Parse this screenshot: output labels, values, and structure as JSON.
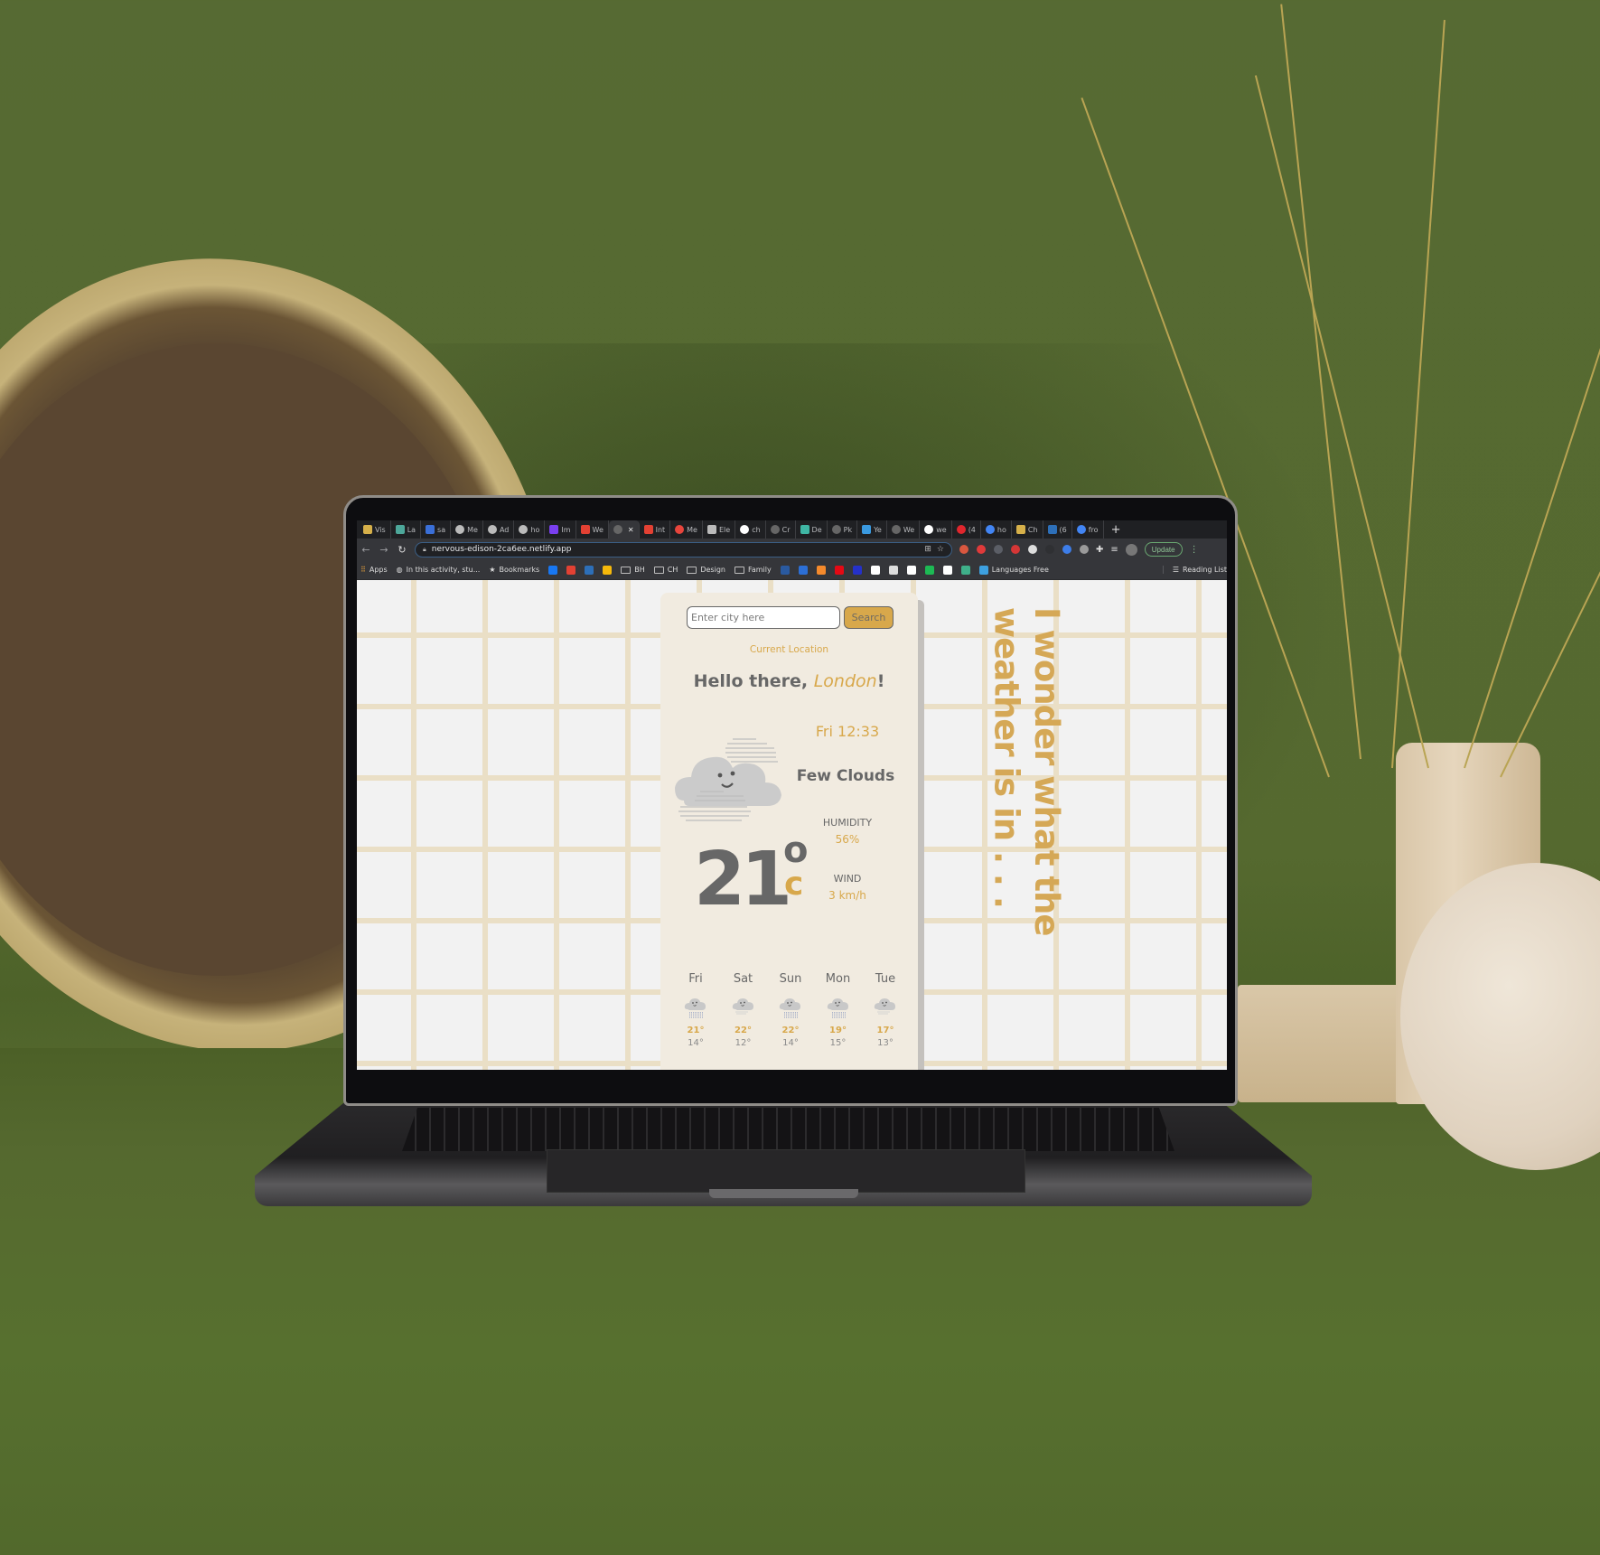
{
  "browser": {
    "tabs": [
      {
        "label": "Vis",
        "icon": "vscode-icon",
        "color": "#d6b04a"
      },
      {
        "label": "La",
        "icon": "app-icon",
        "color": "#4da79a"
      },
      {
        "label": "sa",
        "icon": "s-logo-icon",
        "color": "#3a6fd8"
      },
      {
        "label": "Me",
        "icon": "codesandbox-icon",
        "color": "#bbbbbb"
      },
      {
        "label": "Ad",
        "icon": "codesandbox-icon",
        "color": "#bbbbbb"
      },
      {
        "label": "ho",
        "icon": "codesandbox-icon",
        "color": "#bbbbbb"
      },
      {
        "label": "Im",
        "icon": "bootstrap-icon",
        "color": "#7a3ff0"
      },
      {
        "label": "We",
        "icon": "gmail-icon",
        "color": "#e34133"
      },
      {
        "label": "",
        "icon": "globe-icon",
        "color": "#666666",
        "active": true
      },
      {
        "label": "Int",
        "icon": "gmail-icon",
        "color": "#e34133"
      },
      {
        "label": "Me",
        "icon": "hexagon-icon",
        "color": "#e8453c"
      },
      {
        "label": "Ele",
        "icon": "lock-icon",
        "color": "#bbbbbb"
      },
      {
        "label": "ch",
        "icon": "github-icon",
        "color": "#ffffff"
      },
      {
        "label": "Cr",
        "icon": "globe-icon",
        "color": "#666666"
      },
      {
        "label": "De",
        "icon": "diamond-icon",
        "color": "#3fb6a4"
      },
      {
        "label": "Pk",
        "icon": "globe-icon",
        "color": "#666666"
      },
      {
        "label": "Ye",
        "icon": "grid-icon",
        "color": "#3a9ae0"
      },
      {
        "label": "We",
        "icon": "globe-icon",
        "color": "#666666"
      },
      {
        "label": "we",
        "icon": "github-icon",
        "color": "#ffffff"
      },
      {
        "label": "(4",
        "icon": "pinterest-icon",
        "color": "#e0262d"
      },
      {
        "label": "ho",
        "icon": "google-icon",
        "color": "#4285f4"
      },
      {
        "label": "Ch",
        "icon": "app-icon",
        "color": "#d6b04a"
      },
      {
        "label": "(6",
        "icon": "linkedin-icon",
        "color": "#2d6fb8"
      },
      {
        "label": "fro",
        "icon": "google-icon",
        "color": "#4285f4"
      }
    ],
    "new_tab": "+",
    "url": "nervous-edison-2ca6ee.netlify.app",
    "update_label": "Update",
    "extensions": [
      "#d9573f",
      "#e03a3a",
      "#5b5e66",
      "#d53636",
      "#dddddd",
      "#2f3033",
      "#3d7de8",
      "#9a9a9a"
    ],
    "bookmarks": [
      {
        "label": "Apps",
        "icon": "apps-grid-icon"
      },
      {
        "label": "In this activity, stu...",
        "icon": "globe-icon"
      },
      {
        "label": "Bookmarks",
        "icon": "star-icon"
      },
      {
        "label": "",
        "icon": "facebook-icon",
        "color": "#1877f2"
      },
      {
        "label": "",
        "icon": "gmail-icon",
        "color": "#e34133"
      },
      {
        "label": "",
        "icon": "linkedin-icon",
        "color": "#2d6fb8"
      },
      {
        "label": "",
        "icon": "google-drive-icon",
        "color": "#f6b90b"
      },
      {
        "label": "BH",
        "icon": "folder-icon"
      },
      {
        "label": "CH",
        "icon": "folder-icon"
      },
      {
        "label": "Design",
        "icon": "folder-icon"
      },
      {
        "label": "Family",
        "icon": "folder-icon"
      },
      {
        "label": "",
        "icon": "accessibility-icon",
        "color": "#2a5aa0"
      },
      {
        "label": "",
        "icon": "chase-icon",
        "color": "#2c6fd6"
      },
      {
        "label": "",
        "icon": "orange-circle-icon",
        "color": "#f58a2c"
      },
      {
        "label": "",
        "icon": "netflix-icon",
        "color": "#e50914"
      },
      {
        "label": "",
        "icon": "disney-icon",
        "color": "#2531c9"
      },
      {
        "label": "",
        "icon": "c-logo-icon",
        "color": "#ffffff"
      },
      {
        "label": "",
        "icon": "nytimes-icon",
        "color": "#dddddd"
      },
      {
        "label": "",
        "icon": "amazon-icon",
        "color": "#ffffff"
      },
      {
        "label": "",
        "icon": "spotify-icon",
        "color": "#1db954"
      },
      {
        "label": "",
        "icon": "f-logo-icon",
        "color": "#ffffff"
      },
      {
        "label": "",
        "icon": "robot-icon",
        "color": "#3fb08a"
      },
      {
        "label": "Languages Free",
        "icon": "oc-icon",
        "color": "#3da0e0"
      }
    ],
    "reading_list": "Reading List"
  },
  "weather_app": {
    "search_placeholder": "Enter city here",
    "search_button": "Search",
    "current_location": "Current Location",
    "greeting_prefix": "Hello there, ",
    "city": "London",
    "greeting_suffix": "!",
    "datetime": "Fri 12:33",
    "description": "Few Clouds",
    "humidity_label": "HUMIDITY",
    "humidity_value": "56%",
    "wind_label": "WIND",
    "wind_value": "3 km/h",
    "temperature": "21",
    "degree_symbol": "o",
    "unit": "c",
    "forecast": [
      {
        "day": "Fri",
        "icon": "rain-cloud-icon",
        "high": "21°",
        "low": "14°"
      },
      {
        "day": "Sat",
        "icon": "few-clouds-icon",
        "high": "22°",
        "low": "12°"
      },
      {
        "day": "Sun",
        "icon": "rain-cloud-icon",
        "high": "22°",
        "low": "14°"
      },
      {
        "day": "Mon",
        "icon": "rain-cloud-icon",
        "high": "19°",
        "low": "15°"
      },
      {
        "day": "Tue",
        "icon": "few-clouds-icon",
        "high": "17°",
        "low": "13°"
      }
    ],
    "tagline_line1": "I wonder what the",
    "tagline_line2": "weather is in . . .",
    "colors": {
      "accent": "#d8a84b",
      "text": "#676767",
      "card": "#f1ebe0",
      "grid": "#eadfc6"
    }
  }
}
